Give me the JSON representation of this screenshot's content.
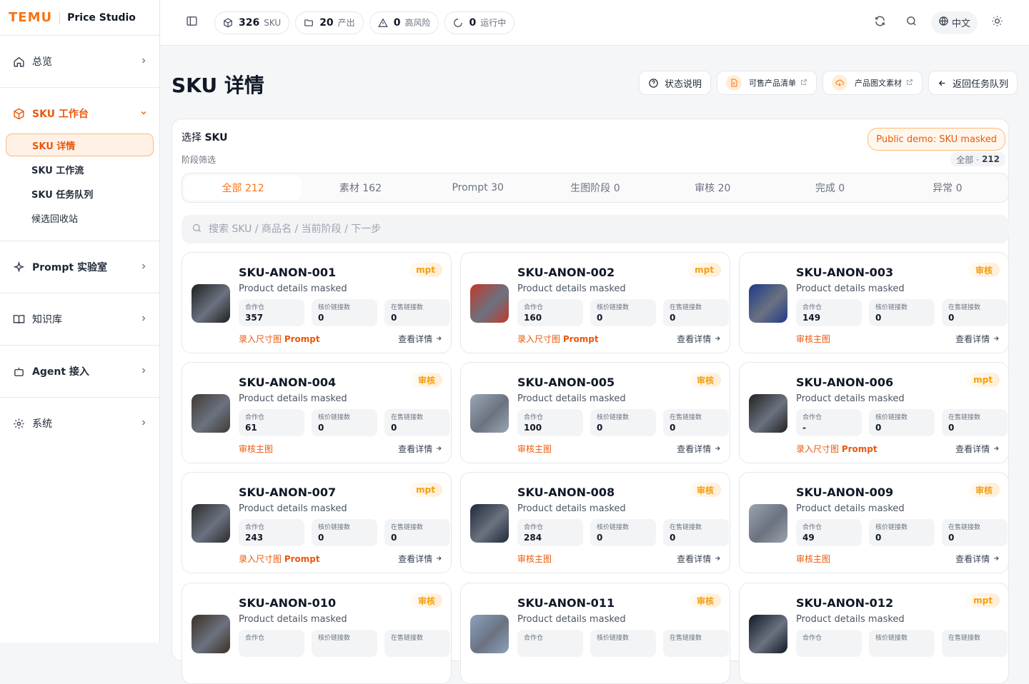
{
  "brand": {
    "logo": "TEMU",
    "name": "Price Studio"
  },
  "sidebar": {
    "items": [
      {
        "label": "总览",
        "icon": "home-icon"
      },
      {
        "label": "SKU 工作台",
        "icon": "box-icon",
        "active": true
      },
      {
        "label": "Prompt 实验室",
        "icon": "sparkle-icon"
      },
      {
        "label": "知识库",
        "icon": "book-icon"
      },
      {
        "label": "Agent 接入",
        "icon": "bot-icon"
      },
      {
        "label": "系统",
        "icon": "gear-icon"
      }
    ],
    "sub_items": [
      "SKU 详情",
      "SKU 工作流",
      "SKU 任务队列",
      "候选回收站"
    ]
  },
  "topbar": {
    "pills": [
      {
        "value": "326",
        "label": "SKU",
        "icon": "cube-icon"
      },
      {
        "value": "20",
        "label": "产出",
        "icon": "folder-icon"
      },
      {
        "value": "0",
        "label": "高风险",
        "icon": "warning-icon"
      },
      {
        "value": "0",
        "label": "运行中",
        "icon": "spinner-icon"
      }
    ],
    "lang": "中文"
  },
  "page": {
    "title": "SKU 详情",
    "actions": {
      "status_help": "状态说明",
      "sellable_list": "可售产品清单",
      "product_assets": "产品图文素材",
      "back": "返回任务队列"
    }
  },
  "panel": {
    "select_prefix": "选择",
    "select_bold": "SKU",
    "stage_filter": "阶段筛选",
    "demo_badge": "Public demo: SKU masked",
    "count_prefix": "全部 ·",
    "count_value": "212",
    "tabs": [
      "全部 212",
      "素材 162",
      "Prompt 30",
      "生图阶段 0",
      "审核 20",
      "完成 0",
      "异常 0"
    ],
    "search_placeholder": "搜索 SKU / 商品名 / 当前阶段 / 下一步"
  },
  "stat_labels": [
    "合作仓",
    "核价链接数",
    "在售链接数"
  ],
  "detail_label": "查看详情",
  "cards": [
    {
      "id": "SKU-ANON-001",
      "sub": "Product details masked",
      "tag": "mpt",
      "stats": [
        "357",
        "0",
        "0"
      ],
      "next": "录入尺寸图",
      "next_bold": "Prompt"
    },
    {
      "id": "SKU-ANON-002",
      "sub": "Product details masked",
      "tag": "mpt",
      "stats": [
        "160",
        "0",
        "0"
      ],
      "next": "录入尺寸图",
      "next_bold": "Prompt"
    },
    {
      "id": "SKU-ANON-003",
      "sub": "Product details masked",
      "tag": "审核",
      "stats": [
        "149",
        "0",
        "0"
      ],
      "next": "审核主图",
      "next_bold": ""
    },
    {
      "id": "SKU-ANON-004",
      "sub": "Product details masked",
      "tag": "审核",
      "stats": [
        "61",
        "0",
        "0"
      ],
      "next": "审核主图",
      "next_bold": ""
    },
    {
      "id": "SKU-ANON-005",
      "sub": "Product details masked",
      "tag": "审核",
      "stats": [
        "100",
        "0",
        "0"
      ],
      "next": "审核主图",
      "next_bold": ""
    },
    {
      "id": "SKU-ANON-006",
      "sub": "Product details masked",
      "tag": "mpt",
      "stats": [
        "-",
        "0",
        "0"
      ],
      "next": "录入尺寸图",
      "next_bold": "Prompt"
    },
    {
      "id": "SKU-ANON-007",
      "sub": "Product details masked",
      "tag": "mpt",
      "stats": [
        "243",
        "0",
        "0"
      ],
      "next": "录入尺寸图",
      "next_bold": "Prompt"
    },
    {
      "id": "SKU-ANON-008",
      "sub": "Product details masked",
      "tag": "审核",
      "stats": [
        "284",
        "0",
        "0"
      ],
      "next": "审核主图",
      "next_bold": ""
    },
    {
      "id": "SKU-ANON-009",
      "sub": "Product details masked",
      "tag": "审核",
      "stats": [
        "49",
        "0",
        "0"
      ],
      "next": "审核主图",
      "next_bold": ""
    },
    {
      "id": "SKU-ANON-010",
      "sub": "Product details masked",
      "tag": "审核",
      "stats": [
        "",
        "",
        ""
      ],
      "next": "",
      "next_bold": ""
    },
    {
      "id": "SKU-ANON-011",
      "sub": "Product details masked",
      "tag": "审核",
      "stats": [
        "",
        "",
        ""
      ],
      "next": "",
      "next_bold": ""
    },
    {
      "id": "SKU-ANON-012",
      "sub": "Product details masked",
      "tag": "mpt",
      "stats": [
        "",
        "",
        ""
      ],
      "next": "",
      "next_bold": ""
    }
  ],
  "thumb_colors": [
    "#1f1f1f",
    "#c0392b",
    "#1e3a8a",
    "#3f3a33",
    "#9aa7b4",
    "#222222",
    "#2b2b2b",
    "#1f2937",
    "#9ca3af",
    "#3b2f24",
    "#8aa3c0",
    "#111827"
  ]
}
